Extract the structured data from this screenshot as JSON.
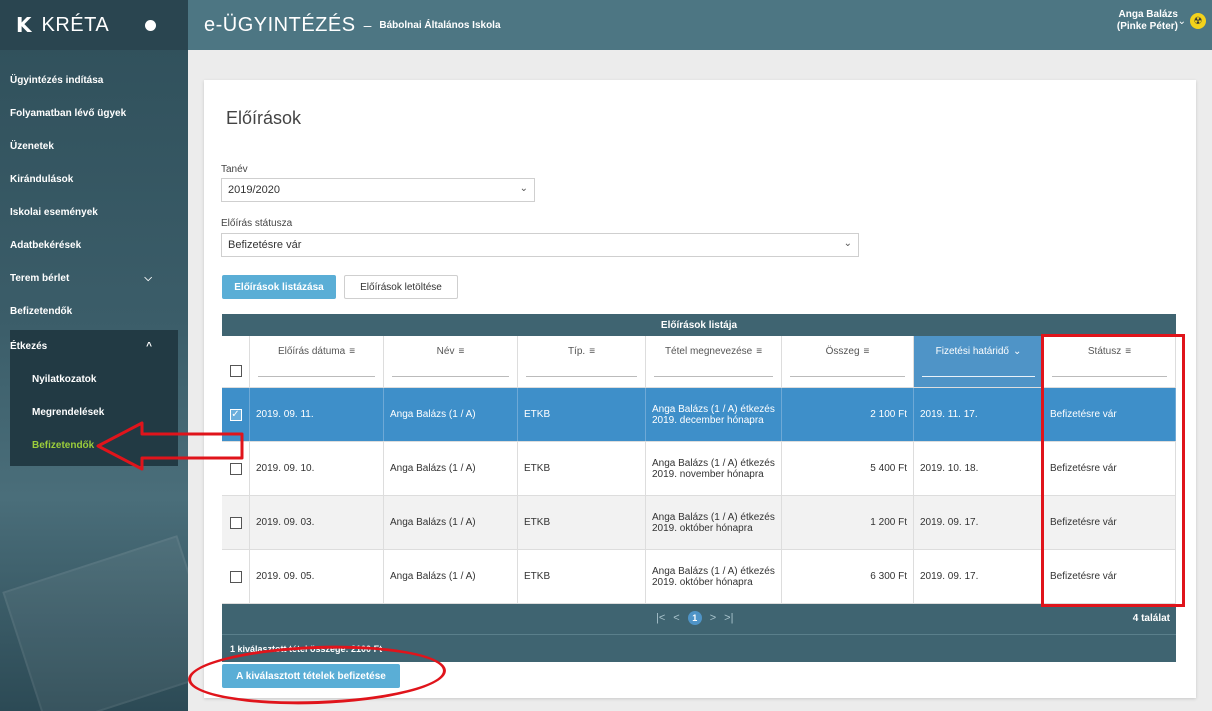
{
  "sidebar": {
    "logo": "K",
    "app_name": "KRÉTA",
    "items": [
      {
        "label": "Ügyintézés indítása"
      },
      {
        "label": "Folyamatban lévő ügyek"
      },
      {
        "label": "Üzenetek"
      },
      {
        "label": "Kirándulások"
      },
      {
        "label": "Iskolai események"
      },
      {
        "label": "Adatbekérések"
      },
      {
        "label": "Terem bérlet"
      },
      {
        "label": "Befizetendők"
      }
    ],
    "group": {
      "label": "Étkezés",
      "subitems": [
        {
          "label": "Nyilatkozatok"
        },
        {
          "label": "Megrendelések"
        },
        {
          "label": "Befizetendők",
          "active": true
        }
      ]
    },
    "icons": {
      "terem_chevron": "chevron-down-icon",
      "group_chevron": "chevron-up-icon"
    }
  },
  "header": {
    "title": "e-ÜGYINTÉZÉS",
    "dash": "–",
    "school": "Bábolnai Általános Iskola",
    "user_name": "Anga Balázs",
    "user_sub": "(Pinke Péter)",
    "user_icon": "radiation-icon"
  },
  "main": {
    "title": "Előírások",
    "tanev": {
      "label": "Tanév",
      "value": "2019/2020"
    },
    "status": {
      "label": "Előírás státusza",
      "value": "Befizetésre vár"
    },
    "list_button": "Előírások listázása",
    "download_button": "Előírások letöltése"
  },
  "table": {
    "caption": "Előírások listája",
    "columns": [
      "Előírás dátuma",
      "Név",
      "Típ.",
      "Tétel megnevezése",
      "Összeg",
      "Fizetési határidő",
      "Státusz"
    ],
    "rows": [
      {
        "date": "2019. 09. 11.",
        "name": "Anga Balázs (1 / A)",
        "type": "ETKB",
        "item": "Anga Balázs (1 / A) étkezés 2019. december hónapra",
        "amount": "2 100 Ft",
        "deadline": "2019. 11. 17.",
        "status": "Befizetésre vár",
        "checked": true
      },
      {
        "date": "2019. 09. 10.",
        "name": "Anga Balázs (1 / A)",
        "type": "ETKB",
        "item": "Anga Balázs (1 / A) étkezés 2019. november hónapra",
        "amount": "5 400 Ft",
        "deadline": "2019. 10. 18.",
        "status": "Befizetésre vár",
        "checked": false
      },
      {
        "date": "2019. 09. 03.",
        "name": "Anga Balázs (1 / A)",
        "type": "ETKB",
        "item": "Anga Balázs (1 / A) étkezés 2019. október hónapra",
        "amount": "1 200 Ft",
        "deadline": "2019. 09. 17.",
        "status": "Befizetésre vár",
        "checked": false
      },
      {
        "date": "2019. 09. 05.",
        "name": "Anga Balázs (1 / A)",
        "type": "ETKB",
        "item": "Anga Balázs (1 / A) étkezés 2019. október hónapra",
        "amount": "6 300 Ft",
        "deadline": "2019. 09. 17.",
        "status": "Befizetésre vár",
        "checked": false
      }
    ],
    "pager": {
      "first": "|<",
      "prev": "<",
      "page": "1",
      "next": ">",
      "last": ">|"
    },
    "result_count": "4 találat",
    "sum_text": "1 kiválasztott tétel összege: 2100 Ft"
  },
  "pay_button": "A kiválasztott tételek befizetése",
  "colors": {
    "accent": "#4f94c7",
    "sidebar": "#2f4f5a",
    "header": "#4d7683",
    "annotation": "#e0141b"
  }
}
